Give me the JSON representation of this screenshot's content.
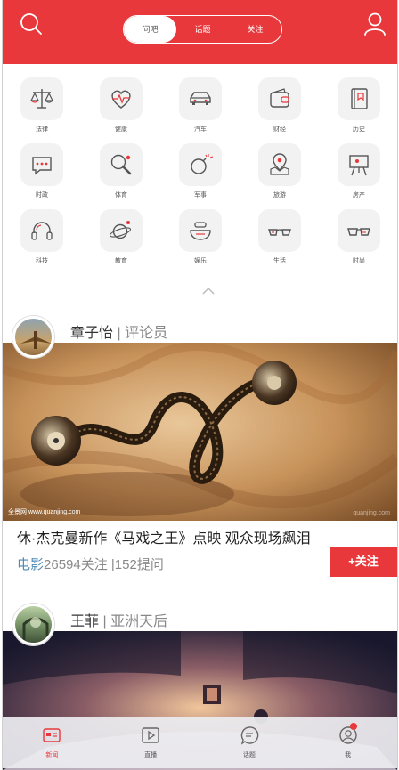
{
  "header": {
    "tabs": [
      {
        "label": "问吧",
        "active": true
      },
      {
        "label": "话题",
        "active": false
      },
      {
        "label": "关注",
        "active": false
      }
    ],
    "accent_color": "#e8383b"
  },
  "categories": [
    {
      "label": "法律",
      "icon": "scales-icon"
    },
    {
      "label": "健康",
      "icon": "heartbeat-icon"
    },
    {
      "label": "汽车",
      "icon": "car-icon"
    },
    {
      "label": "财经",
      "icon": "wallet-icon"
    },
    {
      "label": "历史",
      "icon": "book-icon"
    },
    {
      "label": "时政",
      "icon": "chat-bubble-icon"
    },
    {
      "label": "体育",
      "icon": "ping-pong-icon"
    },
    {
      "label": "军事",
      "icon": "bomb-icon"
    },
    {
      "label": "旅游",
      "icon": "map-pin-icon"
    },
    {
      "label": "房产",
      "icon": "easel-icon"
    },
    {
      "label": "科技",
      "icon": "headphones-icon"
    },
    {
      "label": "教育",
      "icon": "planet-icon"
    },
    {
      "label": "娱乐",
      "icon": "bowl-icon"
    },
    {
      "label": "生活",
      "icon": "glasses-icon"
    },
    {
      "label": "时尚",
      "icon": "sunglasses-icon"
    }
  ],
  "posts": [
    {
      "author": "章子怡",
      "role": "评论员",
      "separator": "|",
      "image_watermark": "全景网 www.quanjing.com",
      "image_watermark_right": "quanjing.com",
      "title": "休·杰克曼新作《马戏之王》点映 观众现场飙泪",
      "tag": "电影",
      "followers": "26594关注",
      "questions": "|152提问",
      "follow_label": "+关注"
    },
    {
      "author": "王菲",
      "role": "亚洲天后",
      "separator": "|"
    }
  ],
  "tabbar": [
    {
      "label": "新闻",
      "icon": "news-icon",
      "active": true
    },
    {
      "label": "直播",
      "icon": "play-icon",
      "active": false
    },
    {
      "label": "话题",
      "icon": "topic-bubble-icon",
      "active": false
    },
    {
      "label": "我",
      "icon": "profile-icon",
      "active": false,
      "badge": true
    }
  ]
}
